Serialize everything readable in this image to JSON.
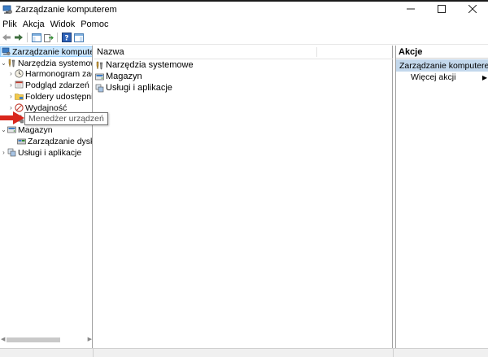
{
  "window": {
    "title": "Zarządzanie komputerem",
    "minimize_icon": "minimize-icon",
    "maximize_icon": "maximize-icon",
    "close_icon": "close-icon"
  },
  "menu": [
    "Plik",
    "Akcja",
    "Widok",
    "Pomoc"
  ],
  "toolbar": {
    "icons": [
      "back-arrow-icon",
      "forward-arrow-icon",
      "show-hide-console-tree-icon",
      "export-list-icon",
      "help-icon",
      "properties-pane-icon"
    ]
  },
  "tree": {
    "root": "Zarządzanie komputerem",
    "system_tools": "Narzędzia systemowe",
    "task_scheduler": "Harmonogram zadań",
    "event_viewer": "Podgląd zdarzeń",
    "shared_folders": "Foldery udostępnione",
    "performance": "Wydajność",
    "device_manager": "Menedżer urządzeń",
    "storage": "Magazyn",
    "disk_management": "Zarządzanie dyskami",
    "services_apps": "Usługi i aplikacje"
  },
  "tooltip": "Menedżer urządzeń",
  "center": {
    "column_name": "Nazwa",
    "items": [
      "Narzędzia systemowe",
      "Magazyn",
      "Usługi i aplikacje"
    ]
  },
  "actions": {
    "title": "Akcje",
    "group": "Zarządzanie komputerem",
    "more_actions": "Więcej akcji"
  },
  "colors": {
    "selection": "#cce8ff",
    "actions_group_bg": "#c3d8ec",
    "annotation_arrow": "#d9261c"
  }
}
